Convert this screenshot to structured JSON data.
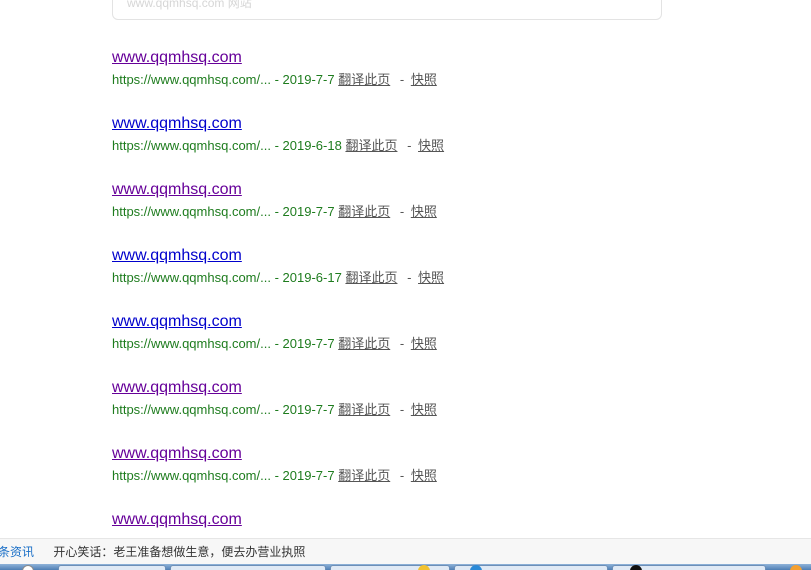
{
  "search_box": {
    "ghost_text": "www.qqmhsq.com  网站"
  },
  "results": [
    {
      "title": "www.qqmhsq.com",
      "visited": true,
      "url": "https://www.qqmhsq.com/...",
      "date": "2019-7-7",
      "translate": "翻译此页",
      "snapshot": "快照"
    },
    {
      "title": "www.qqmhsq.com",
      "visited": false,
      "url": "https://www.qqmhsq.com/...",
      "date": "2019-6-18",
      "translate": "翻译此页",
      "snapshot": "快照"
    },
    {
      "title": "www.qqmhsq.com",
      "visited": true,
      "url": "https://www.qqmhsq.com/...",
      "date": "2019-7-7",
      "translate": "翻译此页",
      "snapshot": "快照"
    },
    {
      "title": "www.qqmhsq.com",
      "visited": false,
      "url": "https://www.qqmhsq.com/...",
      "date": "2019-6-17",
      "translate": "翻译此页",
      "snapshot": "快照"
    },
    {
      "title": "www.qqmhsq.com",
      "visited": false,
      "url": "https://www.qqmhsq.com/...",
      "date": "2019-7-7",
      "translate": "翻译此页",
      "snapshot": "快照"
    },
    {
      "title": "www.qqmhsq.com",
      "visited": true,
      "url": "https://www.qqmhsq.com/...",
      "date": "2019-7-7",
      "translate": "翻译此页",
      "snapshot": "快照"
    },
    {
      "title": "www.qqmhsq.com",
      "visited": true,
      "url": "https://www.qqmhsq.com/...",
      "date": "2019-7-7",
      "translate": "翻译此页",
      "snapshot": "快照"
    },
    {
      "title": "www.qqmhsq.com",
      "visited": true,
      "url": "",
      "date": "",
      "translate": "",
      "snapshot": ""
    }
  ],
  "news_bar": {
    "tag": "条资讯",
    "joke": "开心笑话：老王准备想做生意，便去办营业执照"
  },
  "colors": {
    "visited_link": "#660099",
    "unvisited_link": "#0000cc",
    "url_green": "#1e7c1e",
    "news_tag": "#1a6fc7"
  }
}
